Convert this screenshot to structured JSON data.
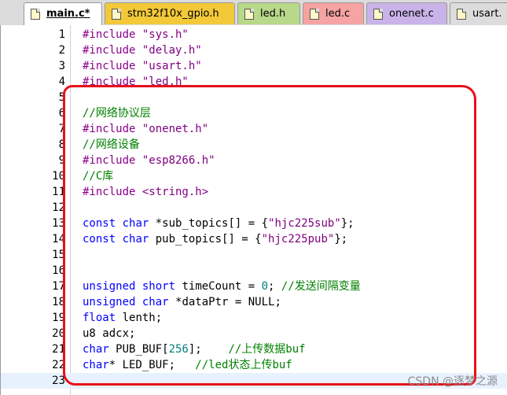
{
  "tabs": [
    {
      "label": "main.c*",
      "active": true,
      "color": "#f3c93a"
    },
    {
      "label": "stm32f10x_gpio.h",
      "active": false,
      "color": "#f3c93a"
    },
    {
      "label": "led.h",
      "active": false,
      "color": "#b8d88a"
    },
    {
      "label": "led.c",
      "active": false,
      "color": "#f5a3a3"
    },
    {
      "label": "onenet.c",
      "active": false,
      "color": "#c9b3e8"
    },
    {
      "label": "usart.",
      "active": false,
      "color": "#dcdcdc"
    }
  ],
  "editor": {
    "current_line": 23,
    "lines": [
      {
        "n": "1",
        "tokens": [
          {
            "t": "#include ",
            "c": "pp"
          },
          {
            "t": "\"sys.h\"",
            "c": "str"
          }
        ]
      },
      {
        "n": "2",
        "tokens": [
          {
            "t": "#include ",
            "c": "pp"
          },
          {
            "t": "\"delay.h\"",
            "c": "str"
          }
        ]
      },
      {
        "n": "3",
        "tokens": [
          {
            "t": "#include ",
            "c": "pp"
          },
          {
            "t": "\"usart.h\"",
            "c": "str"
          }
        ]
      },
      {
        "n": "4",
        "tokens": [
          {
            "t": "#include ",
            "c": "pp"
          },
          {
            "t": "\"led.h\"",
            "c": "str"
          }
        ]
      },
      {
        "n": "5",
        "tokens": []
      },
      {
        "n": "6",
        "tokens": [
          {
            "t": "//网络协议层",
            "c": "cmt"
          }
        ]
      },
      {
        "n": "7",
        "tokens": [
          {
            "t": "#include ",
            "c": "pp"
          },
          {
            "t": "\"onenet.h\"",
            "c": "str"
          }
        ]
      },
      {
        "n": "8",
        "tokens": [
          {
            "t": "//网络设备",
            "c": "cmt"
          }
        ]
      },
      {
        "n": "9",
        "tokens": [
          {
            "t": "#include ",
            "c": "pp"
          },
          {
            "t": "\"esp8266.h\"",
            "c": "str"
          }
        ]
      },
      {
        "n": "10",
        "tokens": [
          {
            "t": "//C库",
            "c": "cmt"
          }
        ]
      },
      {
        "n": "11",
        "tokens": [
          {
            "t": "#include ",
            "c": "pp"
          },
          {
            "t": "<string.h>",
            "c": "str"
          }
        ]
      },
      {
        "n": "12",
        "tokens": []
      },
      {
        "n": "13",
        "tokens": [
          {
            "t": "const",
            "c": "kw"
          },
          {
            "t": " ",
            "c": "plain"
          },
          {
            "t": "char",
            "c": "kw"
          },
          {
            "t": " *sub_topics[] = {",
            "c": "plain"
          },
          {
            "t": "\"hjc225sub\"",
            "c": "str"
          },
          {
            "t": "};",
            "c": "plain"
          }
        ]
      },
      {
        "n": "14",
        "tokens": [
          {
            "t": "const",
            "c": "kw"
          },
          {
            "t": " ",
            "c": "plain"
          },
          {
            "t": "char",
            "c": "kw"
          },
          {
            "t": " pub_topics[] = {",
            "c": "plain"
          },
          {
            "t": "\"hjc225pub\"",
            "c": "str"
          },
          {
            "t": "};",
            "c": "plain"
          }
        ]
      },
      {
        "n": "15",
        "tokens": []
      },
      {
        "n": "16",
        "tokens": []
      },
      {
        "n": "17",
        "tokens": [
          {
            "t": "unsigned",
            "c": "kw"
          },
          {
            "t": " ",
            "c": "plain"
          },
          {
            "t": "short",
            "c": "kw"
          },
          {
            "t": " timeCount = ",
            "c": "plain"
          },
          {
            "t": "0",
            "c": "num"
          },
          {
            "t": "; ",
            "c": "plain"
          },
          {
            "t": "//发送间隔变量",
            "c": "cmt"
          }
        ]
      },
      {
        "n": "18",
        "tokens": [
          {
            "t": "unsigned",
            "c": "kw"
          },
          {
            "t": " ",
            "c": "plain"
          },
          {
            "t": "char",
            "c": "kw"
          },
          {
            "t": " *dataPtr = NULL;",
            "c": "plain"
          }
        ]
      },
      {
        "n": "19",
        "tokens": [
          {
            "t": "float",
            "c": "kw"
          },
          {
            "t": " lenth;",
            "c": "plain"
          }
        ]
      },
      {
        "n": "20",
        "tokens": [
          {
            "t": "u8 adcx;",
            "c": "plain"
          }
        ]
      },
      {
        "n": "21",
        "tokens": [
          {
            "t": "char",
            "c": "kw"
          },
          {
            "t": " PUB_BUF[",
            "c": "plain"
          },
          {
            "t": "256",
            "c": "num"
          },
          {
            "t": "];    ",
            "c": "plain"
          },
          {
            "t": "//上传数据buf",
            "c": "cmt"
          }
        ]
      },
      {
        "n": "22",
        "tokens": [
          {
            "t": "char",
            "c": "kw"
          },
          {
            "t": "* LED_BUF;   ",
            "c": "plain"
          },
          {
            "t": "//led状态上传buf",
            "c": "cmt"
          }
        ]
      },
      {
        "n": "23",
        "tokens": []
      }
    ]
  },
  "watermark": "CSDN @逐梦之源"
}
